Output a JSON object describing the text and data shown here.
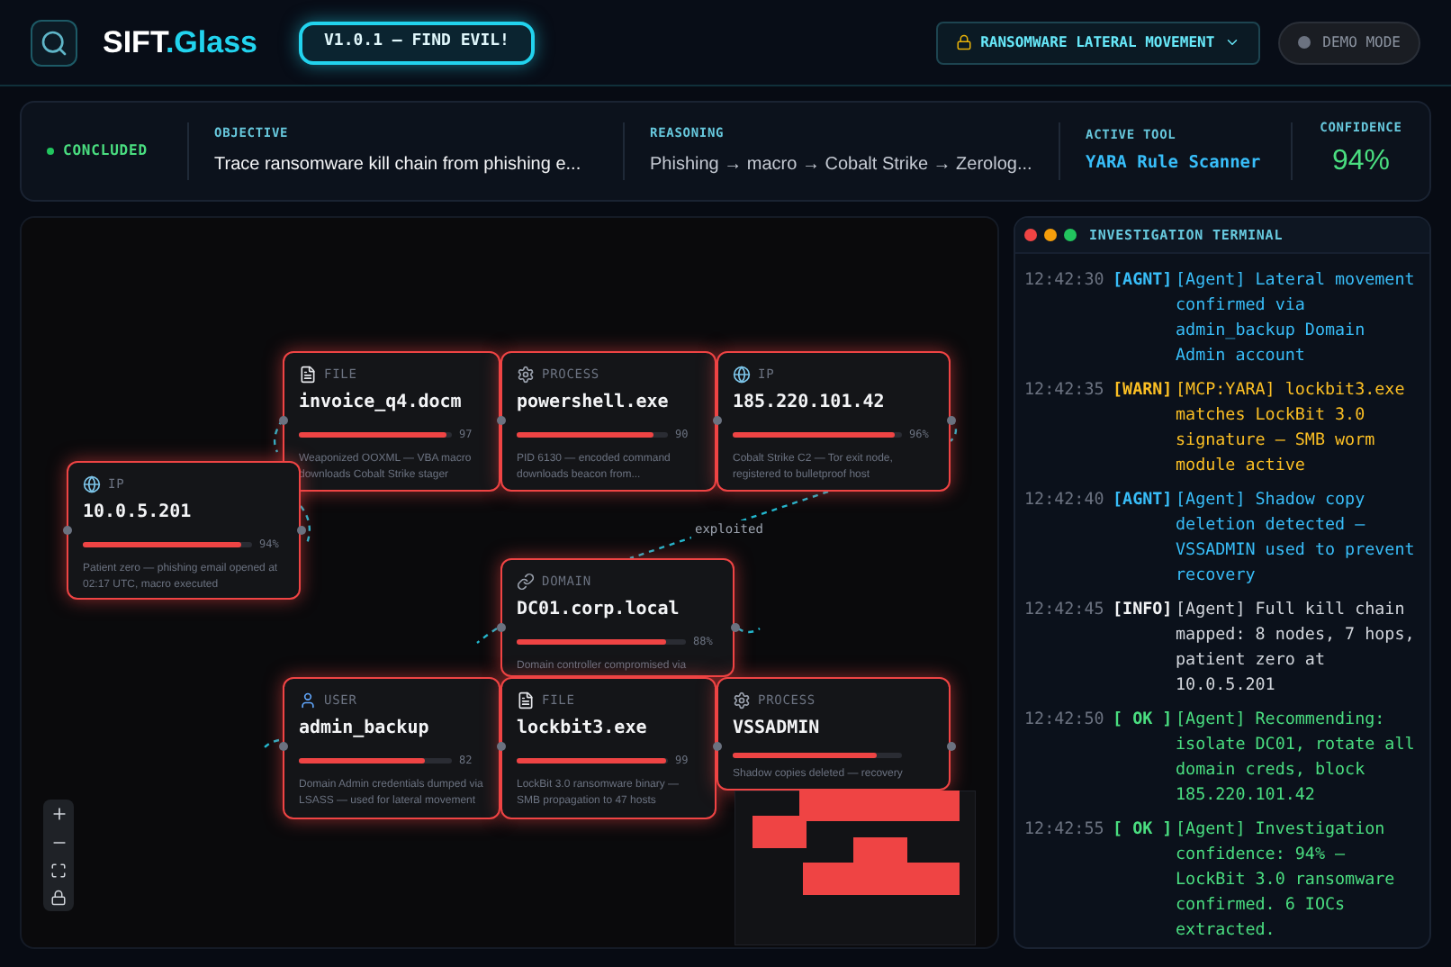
{
  "header": {
    "brand_main": "SIFT",
    "brand_accent": ".Glass",
    "version_badge": "V1.0.1 — FIND EVIL!",
    "scenario": {
      "label": "RANSOMWARE LATERAL MOVEMENT"
    },
    "demo_mode": {
      "label": "DEMO MODE",
      "on": false
    }
  },
  "status_bar": {
    "status": {
      "label": "CONCLUDED",
      "kind": "concluded"
    },
    "objective": {
      "label": "OBJECTIVE",
      "value": "Trace ransomware kill chain from phishing e..."
    },
    "reasoning": {
      "label": "REASONING",
      "value": "Phishing → macro → Cobalt Strike → Zerolog..."
    },
    "active_tool": {
      "label": "ACTIVE TOOL",
      "value": "YARA Rule Scanner"
    },
    "confidence": {
      "label": "CONFIDENCE",
      "value": "94%"
    }
  },
  "graph": {
    "nodes": [
      {
        "kind": "file",
        "type": "FILE",
        "name": "invoice_q4.docm",
        "level": 0.97,
        "percent": "97",
        "description": "Weaponized OOXML — VBA macro downloads Cobalt Strike stager"
      },
      {
        "kind": "process",
        "type": "PROCESS",
        "name": "powershell.exe",
        "level": 0.9,
        "percent": "90",
        "description": "PID 6130 — encoded command downloads beacon from..."
      },
      {
        "kind": "ip",
        "type": "IP",
        "name": "185.220.101.42",
        "level": 0.96,
        "percent": "96%",
        "description": "Cobalt Strike C2 — Tor exit node, registered to bulletproof host"
      },
      {
        "kind": "ip",
        "type": "IP",
        "name": "10.0.5.201",
        "level": 0.94,
        "percent": "94%",
        "description": "Patient zero — phishing email opened at 02:17 UTC, macro executed"
      },
      {
        "kind": "domain",
        "type": "DOMAIN",
        "name": "DC01.corp.local",
        "level": 0.88,
        "percent": "88%",
        "description": "Domain controller compromised via"
      },
      {
        "kind": "user",
        "type": "USER",
        "name": "admin_backup",
        "level": 0.82,
        "percent": "82",
        "description": "Domain Admin credentials dumped via LSASS — used for lateral movement"
      },
      {
        "kind": "file",
        "type": "FILE",
        "name": "lockbit3.exe",
        "level": 0.99,
        "percent": "99",
        "description": "LockBit 3.0 ransomware binary — SMB propagation to 47 hosts"
      },
      {
        "kind": "process",
        "type": "PROCESS",
        "name": "VSSADMIN",
        "level": 0.85,
        "description": "Shadow copies deleted — recovery"
      }
    ],
    "edge_labels": [
      "exploited"
    ]
  },
  "terminal": {
    "title": "INVESTIGATION TERMINAL",
    "entries": [
      {
        "time": "12:42:30",
        "kind": "agnt",
        "tag": "[AGNT]",
        "message": "[Agent] Lateral movement confirmed via admin_backup Domain Admin account"
      },
      {
        "time": "12:42:35",
        "kind": "warn",
        "tag": "[WARN]",
        "message": "[MCP:YARA] lockbit3.exe matches LockBit 3.0 signature — SMB worm module active"
      },
      {
        "time": "12:42:40",
        "kind": "agnt",
        "tag": "[AGNT]",
        "message": "[Agent] Shadow copy deletion detected — VSSADMIN used to prevent recovery"
      },
      {
        "time": "12:42:45",
        "kind": "info",
        "tag": "[INFO]",
        "message": "[Agent] Full kill chain mapped: 8 nodes, 7 hops, patient zero at 10.0.5.201"
      },
      {
        "time": "12:42:50",
        "kind": "ok",
        "tag": "[ OK ]",
        "message": "[Agent] Recommending: isolate DC01, rotate all domain creds, block 185.220.101.42"
      },
      {
        "time": "12:42:55",
        "kind": "ok",
        "tag": "[ OK ]",
        "message": "[Agent] Investigation confidence: 94% — LockBit 3.0 ransomware confirmed. 6 IOCs extracted."
      }
    ]
  }
}
